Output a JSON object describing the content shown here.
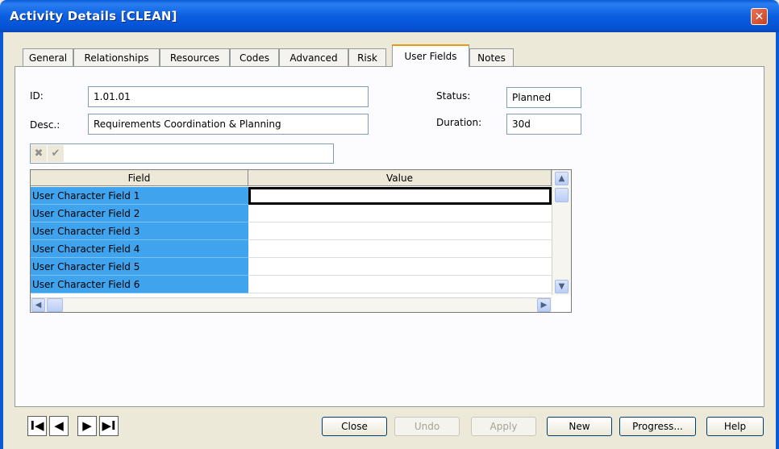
{
  "window": {
    "title": "Activity Details [CLEAN]",
    "close_glyph": "✕"
  },
  "tabs": [
    {
      "label": "General"
    },
    {
      "label": "Relationships"
    },
    {
      "label": "Resources"
    },
    {
      "label": "Codes"
    },
    {
      "label": "Advanced"
    },
    {
      "label": "Risk"
    },
    {
      "label": "User Fields",
      "active": true
    },
    {
      "label": "Notes"
    }
  ],
  "form": {
    "id_label": "ID:",
    "id_value": "1.01.01",
    "desc_label": "Desc.:",
    "desc_value": "Requirements Coordination & Planning",
    "status_label": "Status:",
    "status_value": "Planned",
    "duration_label": "Duration:",
    "duration_value": "30d"
  },
  "editbar": {
    "cancel_glyph": "✖",
    "accept_glyph": "✔",
    "value": ""
  },
  "grid": {
    "headers": [
      "Field",
      "Value"
    ],
    "rows": [
      {
        "field": "User Character Field 1",
        "value": ""
      },
      {
        "field": "User Character Field 2",
        "value": ""
      },
      {
        "field": "User Character Field 3",
        "value": ""
      },
      {
        "field": "User Character Field 4",
        "value": ""
      },
      {
        "field": "User Character Field 5",
        "value": ""
      },
      {
        "field": "User Character Field 6",
        "value": ""
      }
    ]
  },
  "scroll": {
    "up": "▲",
    "down": "▼",
    "left": "◀",
    "right": "▶"
  },
  "nav": {
    "first": "I◀",
    "prev": "◀",
    "next": "▶",
    "last": "▶I"
  },
  "buttons": {
    "close": "Close",
    "undo": "Undo",
    "apply": "Apply",
    "new": "New",
    "progress": "Progress...",
    "help": "Help"
  },
  "colors": {
    "title_bar": "#0b5fe0",
    "active_tab_accent": "#e79a17",
    "field_column_selected": "#3fa3ee",
    "dialog_bg": "#ece9d8"
  }
}
